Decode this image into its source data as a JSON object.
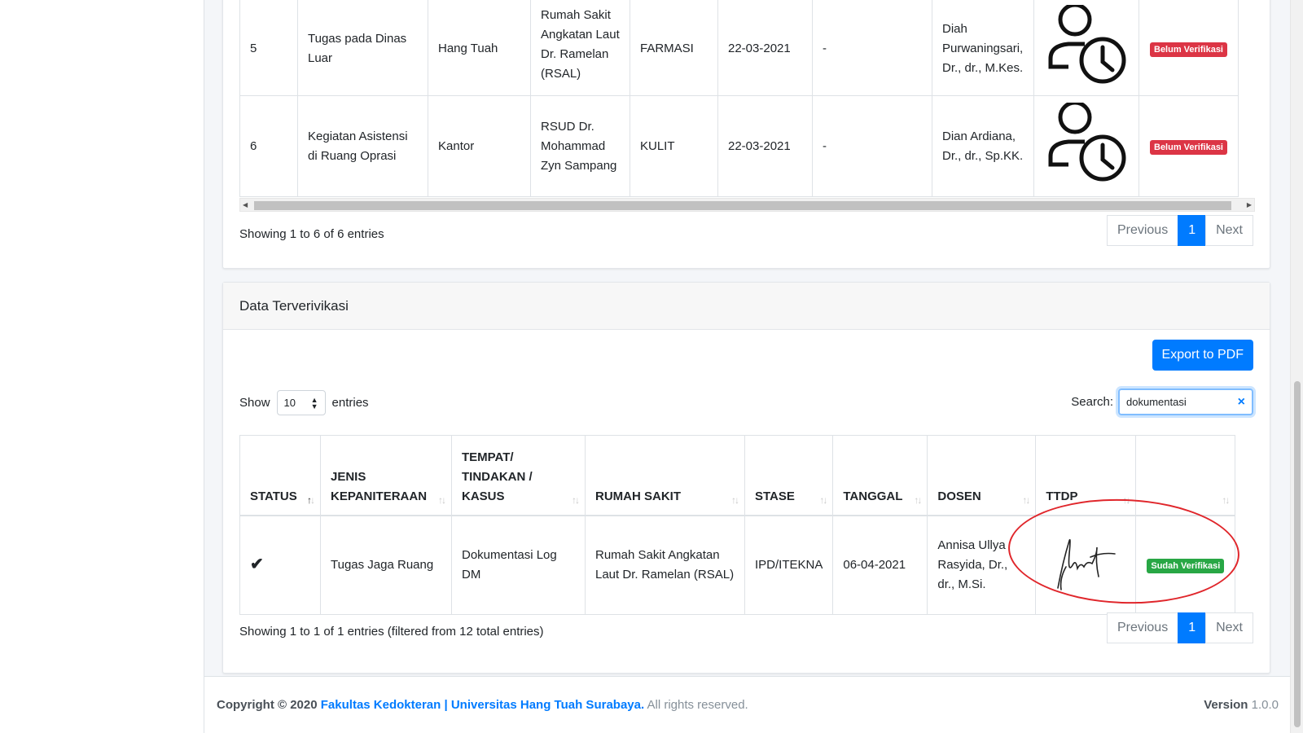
{
  "top_table": {
    "rows": [
      {
        "no": "5",
        "jenis": "Tugas pada Dinas Luar",
        "tempat": "Hang Tuah",
        "rumah_sakit": "Rumah Sakit Angkatan Laut Dr. Ramelan (RSAL)",
        "stase": "FARMASI",
        "tanggal": "22-03-2021",
        "dash": "-",
        "dosen": "Diah Purwaningsari, Dr., dr., M.Kes.",
        "status": "Belum Verifikasi"
      },
      {
        "no": "6",
        "jenis": "Kegiatan Asistensi di Ruang Oprasi",
        "tempat": "Kantor",
        "rumah_sakit": "RSUD Dr. Mohammad Zyn Sampang",
        "stase": "KULIT",
        "tanggal": "22-03-2021",
        "dash": "-",
        "dosen": "Dian Ardiana, Dr., dr., Sp.KK.",
        "status": "Belum Verifikasi"
      }
    ],
    "info": "Showing 1 to 6 of 6 entries",
    "pager": {
      "previous": "Previous",
      "page": "1",
      "next": "Next"
    }
  },
  "verified_card": {
    "title": "Data Terverivikasi",
    "export_label": "Export to PDF",
    "show_label": "Show",
    "show_value": "10",
    "entries_label": "entries",
    "search_label": "Search:",
    "search_value": "dokumentasi",
    "headers": [
      "STATUS",
      "JENIS KEPANITERAAN",
      "TEMPAT/ TINDAKAN / KASUS",
      "RUMAH SAKIT",
      "STASE",
      "TANGGAL",
      "DOSEN",
      "TTDP",
      ""
    ],
    "row": {
      "jenis": "Tugas Jaga Ruang",
      "tempat": "Dokumentasi Log DM",
      "rumah_sakit": "Rumah Sakit Angkatan Laut Dr. Ramelan (RSAL)",
      "stase": "IPD/ITEKNA",
      "tanggal": "06-04-2021",
      "dosen": "Annisa Ullya Rasyida, Dr., dr., M.Si.",
      "status": "Sudah Verifikasi"
    },
    "info": "Showing 1 to 1 of 1 entries (filtered from 12 total entries)",
    "pager": {
      "previous": "Previous",
      "page": "1",
      "next": "Next"
    }
  },
  "footer": {
    "copyright": "Copyright © 2020",
    "org": "Fakultas Kedokteran | Universitas Hang Tuah Surabaya.",
    "rights": "All rights reserved.",
    "version_label": "Version",
    "version_value": "1.0.0"
  },
  "colors": {
    "primary": "#007bff",
    "danger": "#dc3545",
    "success": "#28a745",
    "annotation": "#e0262b"
  },
  "icons": [
    "user-clock-icon",
    "check-icon",
    "clear-icon",
    "sort-icon",
    "signature-image"
  ]
}
